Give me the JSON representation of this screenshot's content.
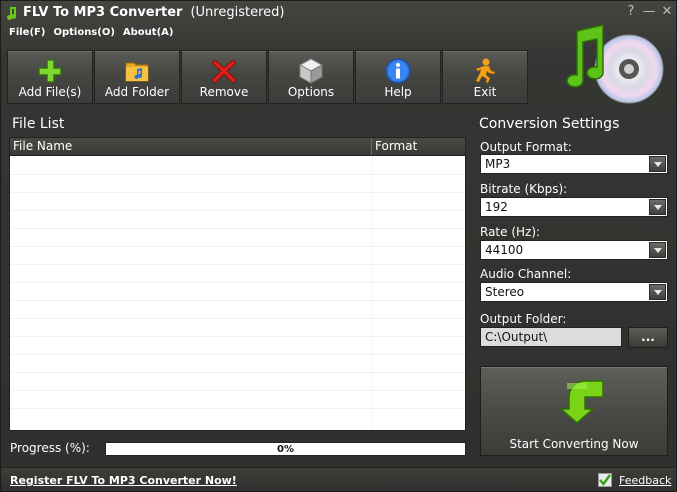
{
  "window": {
    "title": "FLV To MP3 Converter",
    "registration_status": "(Unregistered)",
    "controls": {
      "help": "?",
      "minimize": "—",
      "close": "✕"
    }
  },
  "menu": {
    "items": [
      {
        "label": "File(F)"
      },
      {
        "label": "Options(O)"
      },
      {
        "label": "About(A)"
      }
    ]
  },
  "toolbar": {
    "buttons": [
      {
        "label": "Add File(s)",
        "icon": "plus-icon"
      },
      {
        "label": "Add Folder",
        "icon": "folder-music-icon"
      },
      {
        "label": "Remove",
        "icon": "x-icon"
      },
      {
        "label": "Options",
        "icon": "cube-icon"
      },
      {
        "label": "Help",
        "icon": "info-icon"
      },
      {
        "label": "Exit",
        "icon": "running-man-icon"
      }
    ]
  },
  "file_list": {
    "title": "File List",
    "columns": [
      "File Name",
      "Format"
    ],
    "rows": []
  },
  "progress": {
    "label": "Progress (%):",
    "value": 0,
    "text": "0%"
  },
  "conversion_settings": {
    "title": "Conversion Settings",
    "output_format": {
      "label": "Output Format:",
      "value": "MP3"
    },
    "bitrate": {
      "label": "Bitrate (Kbps):",
      "value": "192"
    },
    "rate": {
      "label": "Rate (Hz):",
      "value": "44100"
    },
    "audio_channel": {
      "label": "Audio Channel:",
      "value": "Stereo"
    },
    "output_folder": {
      "label": "Output Folder:",
      "value": "C:\\Output\\",
      "browse_label": "..."
    },
    "start_button": {
      "label": "Start Converting Now",
      "icon": "green-down-arrow-icon"
    }
  },
  "status_bar": {
    "register_link": "Register FLV To MP3 Converter Now!",
    "feedback": "Feedback"
  },
  "colors": {
    "background": "#353633",
    "accent_green": "#6cc61a",
    "progress_fill": "#7ec7ff"
  }
}
